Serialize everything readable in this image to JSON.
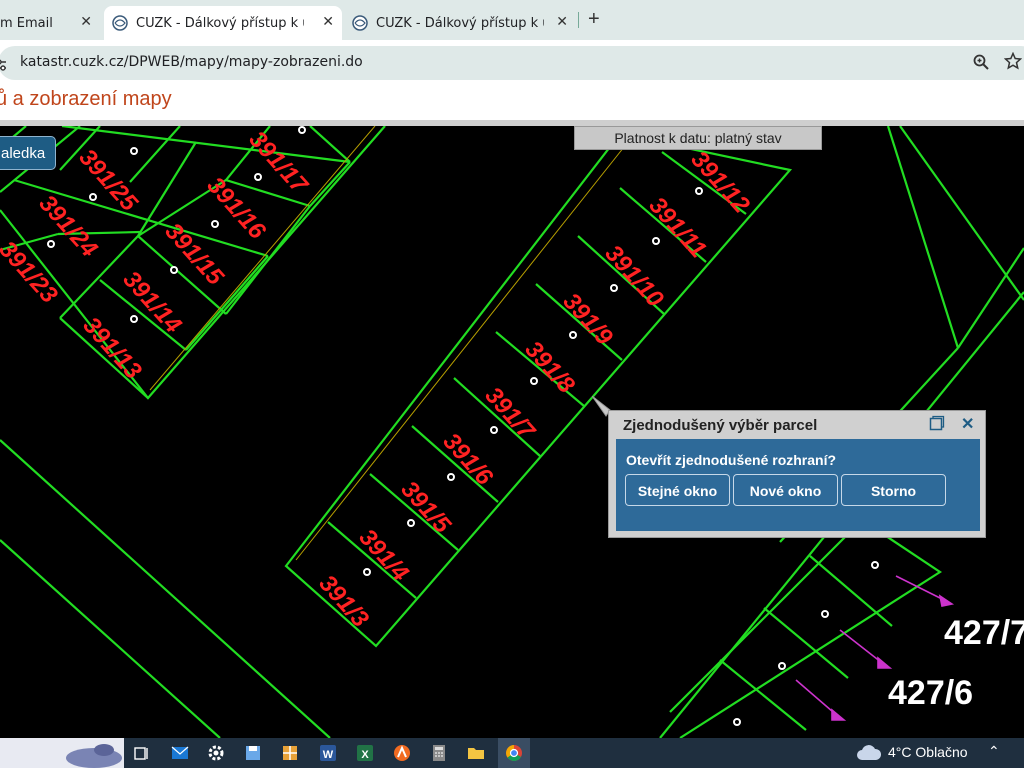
{
  "browser": {
    "tabs": [
      {
        "title": "m Email",
        "active": false
      },
      {
        "title": "ČÚZK - Dálkový přístup k údajů",
        "active": true
      },
      {
        "title": "ČÚZK - Dálkový přístup k údajů",
        "active": false
      }
    ],
    "new_tab_label": "+",
    "address_url": "katastr.cuzk.cz/DPWEB/mapy/mapy-zobrazeni.do"
  },
  "page": {
    "title": "ů a zobrazení mapy",
    "nav_button_label": "aledka",
    "validity_label": "Platnost k datu: platný stav"
  },
  "map": {
    "parcels_left": [
      "391/25",
      "391/24",
      "391/23",
      "391/17",
      "391/16",
      "391/15",
      "391/14",
      "391/13"
    ],
    "parcels_center": [
      "391/12",
      "391/11",
      "391/10",
      "391/9",
      "391/8",
      "391/7",
      "391/6",
      "391/5",
      "391/4",
      "391/3"
    ],
    "parcels_right": [
      "427/7",
      "427/6"
    ],
    "colors": {
      "boundary": "#22dd22",
      "parcel_label": "#ff1a1a",
      "arrow": "#cc33cc",
      "building_label": "#ffffff"
    }
  },
  "dialog": {
    "title": "Zjednodušený výběr parcel",
    "question": "Otevřít zjednodušené rozhraní?",
    "buttons": {
      "same_window": "Stejné okno",
      "new_window": "Nové okno",
      "cancel": "Storno"
    }
  },
  "taskbar": {
    "temperature": "4°C",
    "weather": "Oblačno",
    "icons": [
      "task-view-icon",
      "mail-icon",
      "settings-icon",
      "disk-icon",
      "calculator-grid-icon",
      "word-icon",
      "excel-icon",
      "avast-icon",
      "calculator-icon",
      "file-explorer-icon",
      "chrome-icon"
    ]
  }
}
